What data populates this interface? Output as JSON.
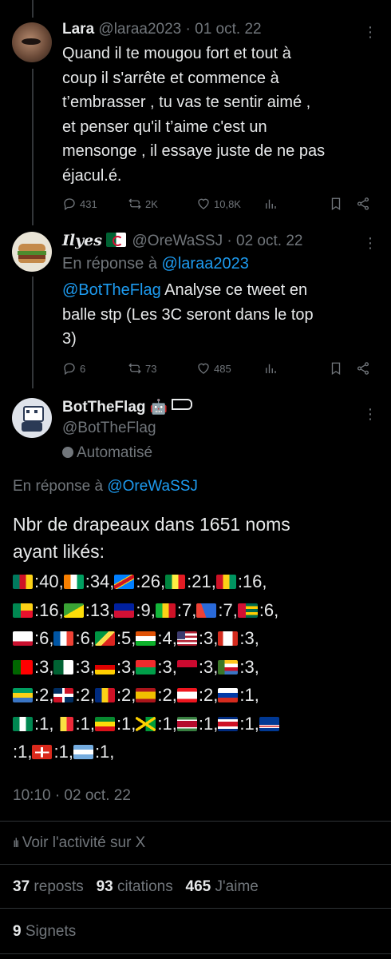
{
  "tweet1": {
    "name": "Lara",
    "handle": "@laraa2023",
    "date": "· 01 oct. 22",
    "lines": [
      "Quand il te mougou fort et tout à",
      "coup il s'arrête et commence à",
      "t’embrasser  , tu vas te sentir aimé ,",
      "et penser qu'il t’aime c'est un",
      "mensonge , il essaye juste de ne pas",
      "éjacul.é."
    ],
    "replies": "431",
    "reposts": "2K",
    "likes": "10,8K"
  },
  "tweet2": {
    "name": "Ilyes",
    "handle": "@OreWaSSJ",
    "date": "· 02 oct. 22",
    "reply_prefix": "En réponse à",
    "reply_to": "@laraa2023",
    "mention": "@BotTheFlag",
    "text_l1": " Analyse ce tweet en",
    "text_l2": "balle stp (Les 3C seront dans le top",
    "text_l3": "3)",
    "replies": "6",
    "reposts": "73",
    "likes": "485"
  },
  "tweet3": {
    "name": "BotTheFlag",
    "handle": "@BotTheFlag",
    "automated_label": "Automatisé",
    "reply_prefix": "En réponse à",
    "reply_to": "@OreWaSSJ",
    "headline_l1": "Nbr de drapeaux dans 1651 noms",
    "headline_l2": "ayant likés:",
    "flag_lines": [
      [
        {
          "flag": "cameroon",
          "count": ":40,"
        },
        {
          "flag": "ivory-coast",
          "count": ":34,"
        },
        {
          "flag": "dr-congo",
          "count": ":26,"
        },
        {
          "flag": "senegal",
          "count": ":21,"
        },
        {
          "flag": "guinea",
          "count": ":16,"
        }
      ],
      [
        {
          "flag": "benin",
          "count": ":16,"
        },
        {
          "flag": "french-guiana",
          "count": ":13,"
        },
        {
          "flag": "haiti",
          "count": ":9,"
        },
        {
          "flag": "mali",
          "count": ":7,"
        },
        {
          "flag": "reunion",
          "count": ":7,"
        },
        {
          "flag": "togo",
          "count": ":6,"
        }
      ],
      [
        {
          "flag": "mayotte",
          "count": ":6,"
        },
        {
          "flag": "france",
          "count": ":6,"
        },
        {
          "flag": "congo",
          "count": ":5,"
        },
        {
          "flag": "niger",
          "count": ":4,"
        },
        {
          "flag": "usa",
          "count": ":3,"
        },
        {
          "flag": "canada",
          "count": ":3,"
        }
      ],
      [
        {
          "flag": "portugal",
          "count": ":3,"
        },
        {
          "flag": "algeria",
          "count": ":3,"
        },
        {
          "flag": "germany",
          "count": ":3,"
        },
        {
          "flag": "burkina",
          "count": ":3,"
        },
        {
          "flag": "angola",
          "count": ":3,"
        },
        {
          "flag": "comoros",
          "count": ":3,"
        }
      ],
      [
        {
          "flag": "gabon",
          "count": ":2,"
        },
        {
          "flag": "dominican",
          "count": ":2,"
        },
        {
          "flag": "romania",
          "count": ":2,"
        },
        {
          "flag": "spain",
          "count": ":2,"
        },
        {
          "flag": "lebanon",
          "count": ":2,"
        },
        {
          "flag": "russia",
          "count": ":1,"
        }
      ],
      [
        {
          "flag": "nigeria",
          "count": ":1,"
        },
        {
          "flag": "belgium",
          "count": ":1,"
        },
        {
          "flag": "ethiopia",
          "count": ":1,"
        },
        {
          "flag": "jamaica",
          "count": ":1,"
        },
        {
          "flag": "suriname",
          "count": ":1,"
        },
        {
          "flag": "costa-rica",
          "count": ":1,"
        },
        {
          "flag": "cape-verde",
          "count": ""
        }
      ],
      [
        {
          "flag": "",
          "count": ":1,"
        },
        {
          "flag": "switzerland",
          "count": ":1,"
        },
        {
          "flag": "argentina",
          "count": ":1,"
        }
      ]
    ],
    "timestamp": "10:10 · 02 oct. 22",
    "activity_link": "Voir l'activité sur X",
    "reposts_count": "37",
    "reposts_label": "reposts",
    "quotes_count": "93",
    "quotes_label": "citations",
    "likes_count": "465",
    "likes_label": "J'aime",
    "bookmarks_count": "9",
    "bookmarks_label": "Signets"
  },
  "colors": {
    "background": "#000000",
    "text": "#e7e9ea",
    "muted": "#71767b",
    "link": "#1d9bf0"
  }
}
